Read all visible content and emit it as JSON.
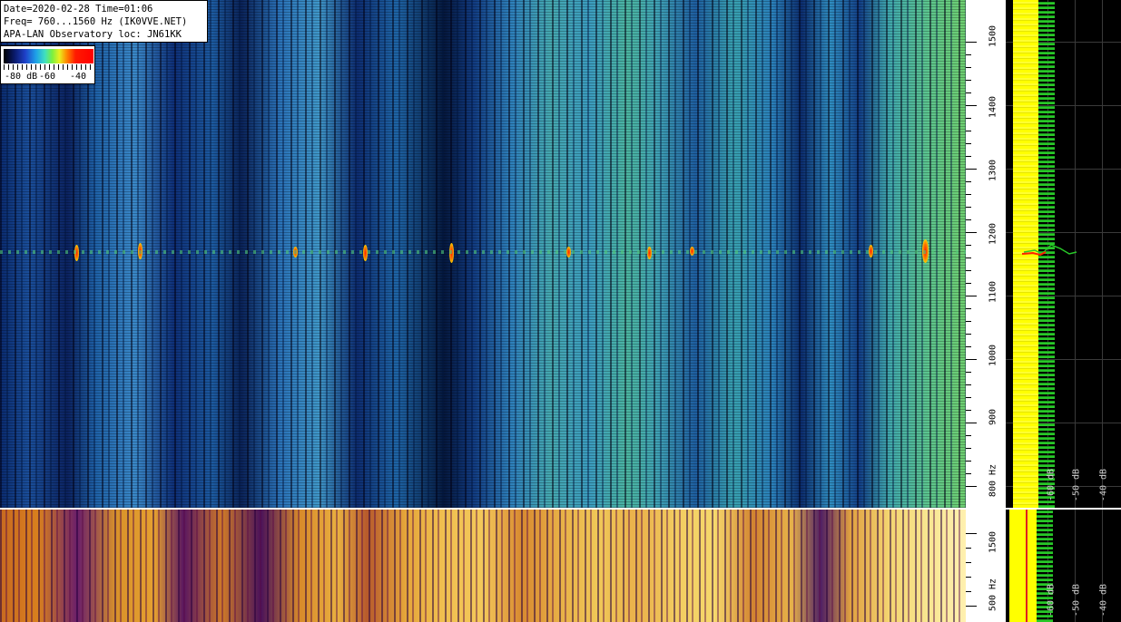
{
  "info": {
    "line1": "Date=2020-02-28 Time=01:06",
    "line2": "Freq= 760...1560 Hz (IK0VVE.NET)",
    "line3": "APA-LAN Observatory loc: JN61KK"
  },
  "legend": {
    "label_80": "-80 dB",
    "label_60": "-60",
    "label_40": "-40"
  },
  "freq_scale_main": [
    "1500",
    "1400",
    "1300",
    "1200",
    "1100",
    "1000",
    "900",
    "800 Hz"
  ],
  "freq_scale_low": [
    "1500",
    "500 Hz"
  ],
  "db_scale_main": [
    "-60 dB",
    "-50 dB",
    "-40 dB"
  ],
  "db_scale_low": [
    "-60 dB",
    "-50 dB",
    "-40 dB"
  ],
  "colors": {
    "waterfall_main": "#1e5ea0",
    "waterfall_low": "#e6a030",
    "spectrum_avg": "#ffff00",
    "spectrum_peak": "#28c828",
    "signal": "#ff2000"
  }
}
